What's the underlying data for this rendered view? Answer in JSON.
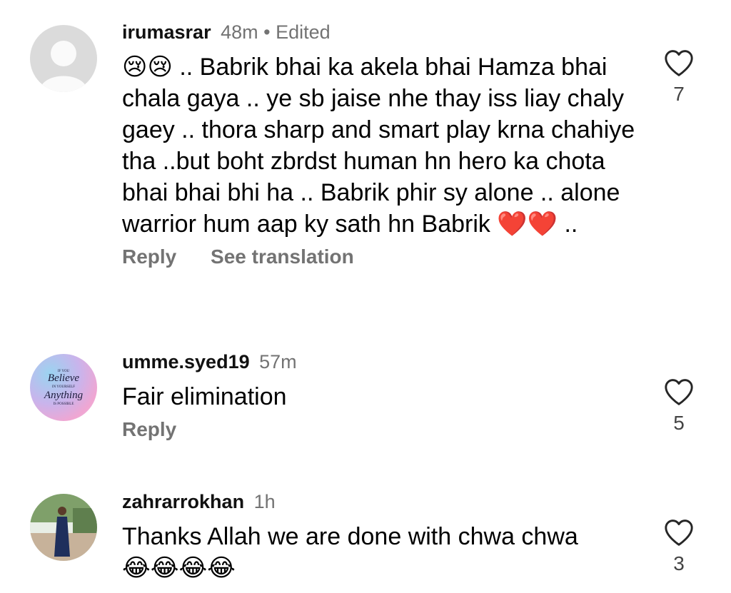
{
  "comments": [
    {
      "username": "irumasrar",
      "time": "48m",
      "edited": "Edited",
      "text": "😢😢 .. Babrik bhai ka akela bhai Hamza bhai chala gaya .. ye sb jaise nhe thay iss liay chaly gaey .. thora sharp and smart play krna chahiye tha ..but boht zbrdst human hn hero ka chota bhai bhai bhi ha .. Babrik phir sy alone .. alone warrior hum aap ky sath hn Babrik ❤️❤️ ..",
      "reply_label": "Reply",
      "translation_label": "See translation",
      "likes": "7",
      "avatar": "default-person"
    },
    {
      "username": "umme.syed19",
      "time": "57m",
      "text": "Fair elimination",
      "reply_label": "Reply",
      "likes": "5",
      "avatar": "believe-in-yourself",
      "avatar_text": {
        "line1": "IF YOU",
        "line2": "Believe",
        "line3": "IN YOURSELF",
        "line4": "Anything",
        "line5": "IS POSSIBLE"
      }
    },
    {
      "username": "zahrarrokhan",
      "time": "1h",
      "text": "Thanks Allah we are done with chwa chwa 😂😂😂😂",
      "likes": "3",
      "avatar": "person-photo"
    }
  ],
  "colors": {
    "muted": "#737373",
    "text": "#000000",
    "background": "#ffffff",
    "avatar_default": "#dbdbdb"
  }
}
